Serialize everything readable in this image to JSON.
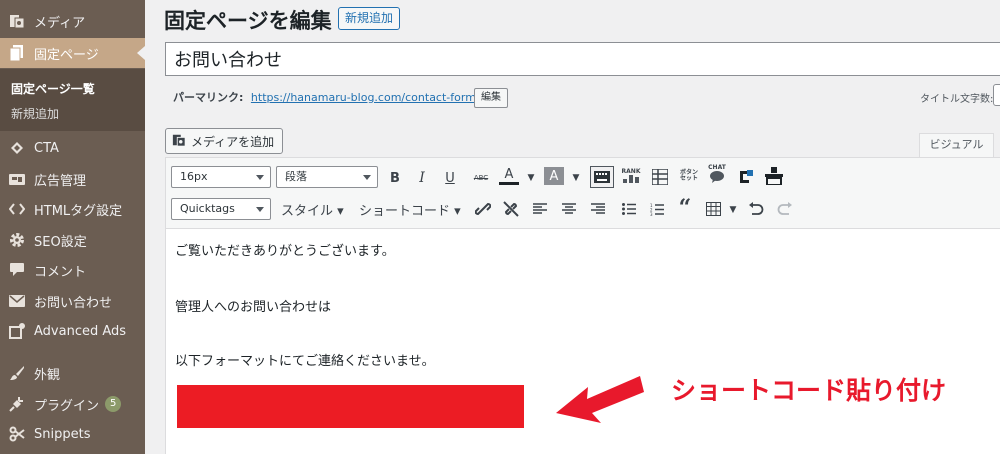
{
  "sidebar": {
    "items": [
      {
        "label": "メディア",
        "icon": "media-icon"
      },
      {
        "label": "固定ページ",
        "icon": "page-icon"
      },
      {
        "label": "CTA",
        "icon": "cta-icon"
      },
      {
        "label": "広告管理",
        "icon": "ads-icon"
      },
      {
        "label": "HTMLタグ設定",
        "icon": "code-icon"
      },
      {
        "label": "SEO設定",
        "icon": "gear-icon"
      },
      {
        "label": "コメント",
        "icon": "comment-icon"
      },
      {
        "label": "お問い合わせ",
        "icon": "mail-icon"
      },
      {
        "label": "Advanced Ads",
        "icon": "advanced-ads-icon"
      },
      {
        "label": "外観",
        "icon": "brush-icon"
      },
      {
        "label": "プラグイン",
        "icon": "plugin-icon",
        "badge": "5"
      },
      {
        "label": "Snippets",
        "icon": "scissors-icon"
      }
    ],
    "submenu": [
      "固定ページ一覧",
      "新規追加"
    ]
  },
  "header": {
    "title": "固定ページを編集",
    "new_button": "新規追加"
  },
  "post": {
    "title": "お問い合わせ",
    "permalink_label": "パーマリンク:",
    "permalink_url": "https://hanamaru-blog.com/contact-form/",
    "edit_button": "編集",
    "title_count_label": "タイトル文字数:"
  },
  "editor": {
    "add_media": "メディアを追加",
    "tab_visual": "ビジュアル",
    "font_size": "16px",
    "paragraph": "段落",
    "quicktags": "Quicktags",
    "style_menu": "スタイル ▾",
    "shortcode_menu": "ショートコード ▾",
    "rank_label": "RANK",
    "button_label": "ボタン セット",
    "chat_label": "CHAT",
    "lines": [
      "ご覧いただきありがとうございます。",
      "管理人へのお問い合わせは",
      "以下フォーマットにてご連絡くださいませ。"
    ]
  },
  "annotation": {
    "text": "ショートコード貼り付け",
    "color": "#e8192c",
    "bar_color": "#ec1c24"
  }
}
